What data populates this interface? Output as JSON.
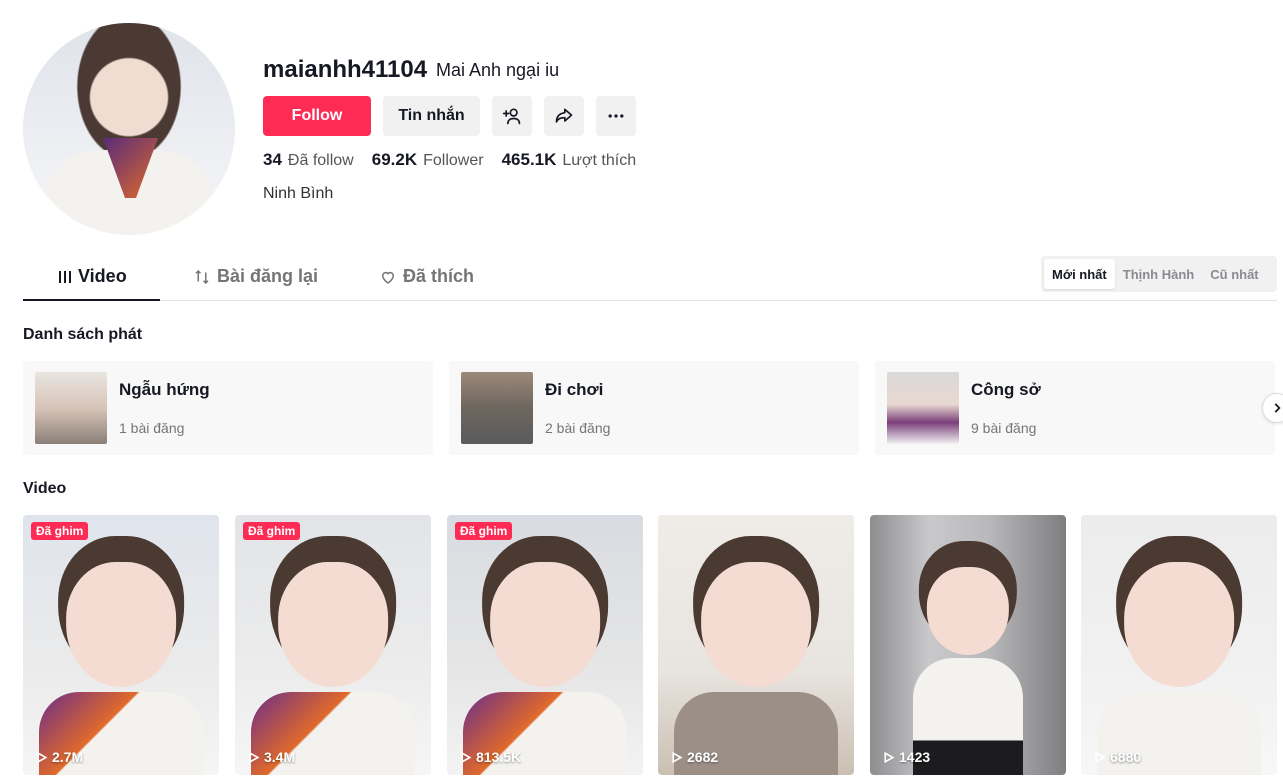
{
  "profile": {
    "username": "maianhh41104",
    "nickname": "Mai Anh ngại iu",
    "follow_label": "Follow",
    "message_label": "Tin nhắn",
    "following_count": "34",
    "following_label": "Đã follow",
    "followers_count": "69.2K",
    "followers_label": "Follower",
    "likes_count": "465.1K",
    "likes_label": "Lượt thích",
    "bio": "Ninh Bình"
  },
  "tabs": [
    {
      "label": "Video",
      "icon": "grid-bars-icon"
    },
    {
      "label": "Bài đăng lại",
      "icon": "repost-icon"
    },
    {
      "label": "Đã thích",
      "icon": "heart-icon"
    }
  ],
  "sort": [
    "Mới nhất",
    "Thịnh Hành",
    "Cũ nhất"
  ],
  "playlists_title": "Danh sách phát",
  "playlists": [
    {
      "name": "Ngẫu hứng",
      "count": "1 bài đăng"
    },
    {
      "name": "Đi chơi",
      "count": "2 bài đăng"
    },
    {
      "name": "Công sở",
      "count": "9 bài đăng"
    }
  ],
  "videos_title": "Video",
  "videos": [
    {
      "views": "2.7M",
      "pinned": "Đã ghim"
    },
    {
      "views": "3.4M",
      "pinned": "Đã ghim"
    },
    {
      "views": "813.5K",
      "pinned": "Đã ghim"
    },
    {
      "views": "2682"
    },
    {
      "views": "1423"
    },
    {
      "views": "6880"
    }
  ],
  "colors": {
    "accent": "#fe2c55",
    "text": "#161823"
  }
}
